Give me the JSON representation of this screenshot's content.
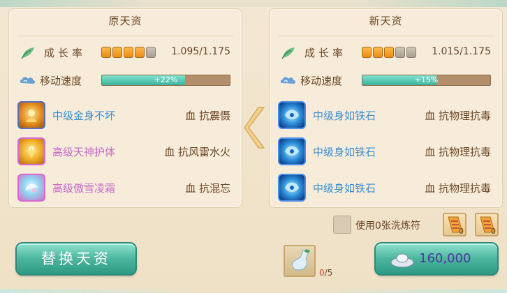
{
  "left_panel": {
    "title": "原天资",
    "growth": {
      "label": "成长率",
      "stars_total": 5,
      "stars_filled": 4,
      "value": "1.095/1.175"
    },
    "speed": {
      "label": "移动速度",
      "bar_fraction": 0.65,
      "bonus": "+22%"
    },
    "skills": [
      {
        "icon": "golden-body-icon",
        "name": "中级金身不坏",
        "attr": "血 抗震慑",
        "name_color": "#3a8ed6"
      },
      {
        "icon": "divine-protection-icon",
        "name": "高级天神护体",
        "attr": "血 抗风雷水火",
        "name_color": "#c76ac9"
      },
      {
        "icon": "frost-icon",
        "name": "高级傲雪凌霜",
        "attr": "血 抗混忘",
        "name_color": "#c76ac9"
      }
    ]
  },
  "right_panel": {
    "title": "新天资",
    "growth": {
      "label": "成长率",
      "stars_total": 5,
      "stars_filled": 3,
      "value": "1.015/1.175"
    },
    "speed": {
      "label": "移动速度",
      "bar_fraction": 0.58,
      "bonus": "+15%"
    },
    "skills": [
      {
        "icon": "iron-body-icon",
        "name": "中级身如铁石",
        "attr": "血 抗物理抗毒",
        "name_color": "#3a8ed6"
      },
      {
        "icon": "iron-body-icon",
        "name": "中级身如铁石",
        "attr": "血 抗物理抗毒",
        "name_color": "#3a8ed6"
      },
      {
        "icon": "iron-body-icon",
        "name": "中级身如铁石",
        "attr": "血 抗物理抗毒",
        "name_color": "#3a8ed6"
      }
    ]
  },
  "wash": {
    "label": "使用0张洗炼符",
    "items": [
      {
        "icon": "wash-talisman-icon",
        "count": "0"
      },
      {
        "icon": "wash-talisman-icon",
        "count": "0"
      }
    ]
  },
  "replace_button": {
    "label": "替换天资"
  },
  "potion": {
    "icon": "potion-bottle-icon",
    "have": "0",
    "need": "/5"
  },
  "cost": {
    "icon": "silver-ingot-icon",
    "value": "160,000"
  },
  "colors": {
    "accent": "#4bb59e",
    "panel": "#f6ecd9",
    "text": "#6b4626"
  }
}
